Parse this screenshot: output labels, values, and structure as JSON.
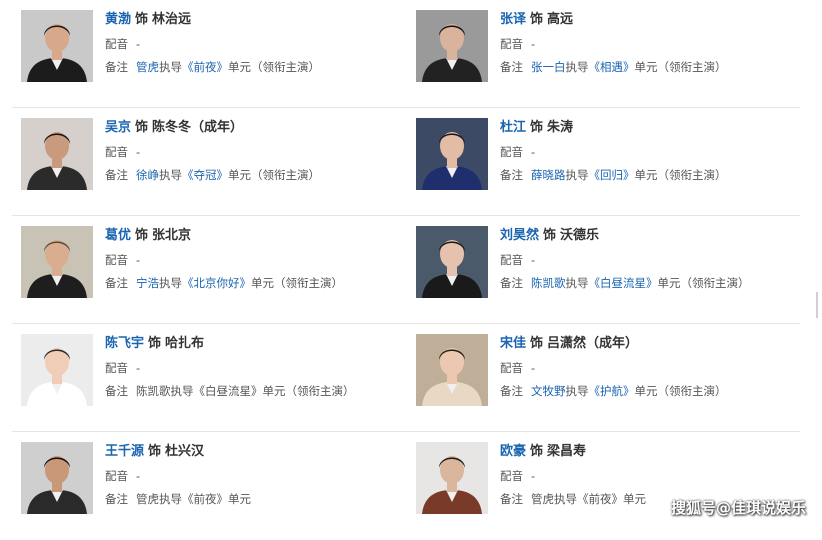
{
  "labels": {
    "role_sep": "饰",
    "voice": "配音",
    "note": "备注"
  },
  "entries": [
    {
      "actor": "黄渤",
      "role": "林治远",
      "voice": "-",
      "note_link": "管虎",
      "note_mid": "执导",
      "note_title": "《前夜》",
      "note_tail": "单元（领衔主演）",
      "note_link_colored": true
    },
    {
      "actor": "张译",
      "role": "高远",
      "voice": "-",
      "note_link": "张一白",
      "note_mid": "执导",
      "note_title": "《相遇》",
      "note_tail": "单元（领衔主演）",
      "note_link_colored": true
    },
    {
      "actor": "吴京",
      "role": "陈冬冬（成年）",
      "voice": "-",
      "note_link": "徐峥",
      "note_mid": "执导",
      "note_title": "《夺冠》",
      "note_tail": "单元（领衔主演）",
      "note_link_colored": true
    },
    {
      "actor": "杜江",
      "role": "朱涛",
      "voice": "-",
      "note_link": "薛晓路",
      "note_mid": "执导",
      "note_title": "《回归》",
      "note_tail": "单元（领衔主演）",
      "note_link_colored": true
    },
    {
      "actor": "葛优",
      "role": "张北京",
      "voice": "-",
      "note_link": "宁浩",
      "note_mid": "执导",
      "note_title": "《北京你好》",
      "note_tail": "单元（领衔主演）",
      "note_link_colored": true
    },
    {
      "actor": "刘昊然",
      "role": "沃德乐",
      "voice": "-",
      "note_link": "陈凯歌",
      "note_mid": "执导",
      "note_title": "《白昼流星》",
      "note_tail": "单元（领衔主演）",
      "note_link_colored": true
    },
    {
      "actor": "陈飞宇",
      "role": "哈扎布",
      "voice": "-",
      "note_link": "陈凯歌",
      "note_mid": "执导",
      "note_title": "《白昼流星》",
      "note_tail": "单元（领衔主演）",
      "note_link_colored": false
    },
    {
      "actor": "宋佳",
      "role": "吕潇然（成年）",
      "voice": "-",
      "note_link": "文牧野",
      "note_mid": "执导",
      "note_title": "《护航》",
      "note_tail": "单元（领衔主演）",
      "note_link_colored": true
    },
    {
      "actor": "王千源",
      "role": "杜兴汉",
      "voice": "-",
      "note_link": "管虎",
      "note_mid": "执导",
      "note_title": "《前夜》",
      "note_tail": "单元",
      "note_link_colored": false
    },
    {
      "actor": "欧豪",
      "role": "梁昌寿",
      "voice": "-",
      "note_link": "管虎",
      "note_mid": "执导",
      "note_title": "《前夜》",
      "note_tail": "单元",
      "note_link_colored": false
    }
  ],
  "watermark": "搜狐号@佳琪说娱乐",
  "colors": {
    "link": "#1a64b0",
    "text": "#333333",
    "separator": "#e6e6e6"
  }
}
